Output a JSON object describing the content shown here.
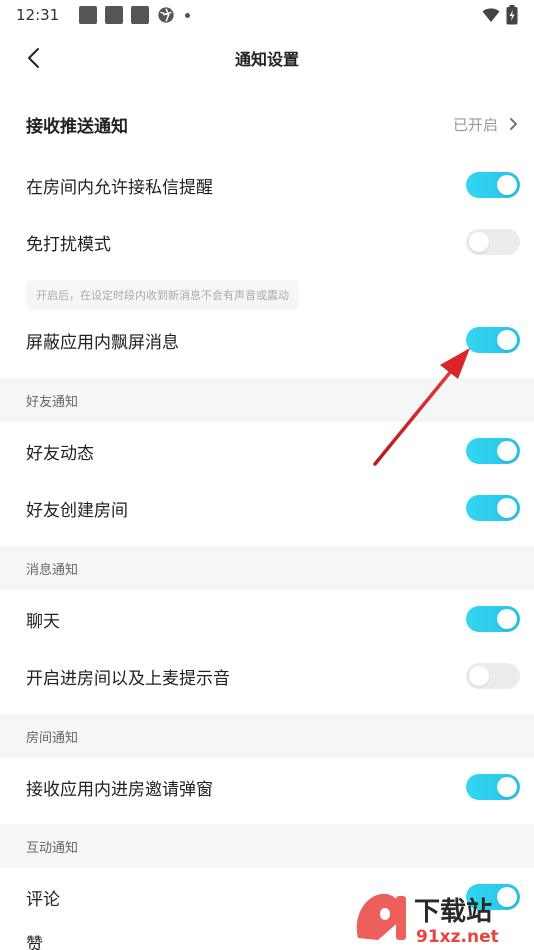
{
  "status_bar": {
    "time": "12:31"
  },
  "header": {
    "title": "通知设置"
  },
  "push": {
    "label": "接收推送通知",
    "status": "已开启"
  },
  "rows": {
    "private_msg": {
      "label": "在房间内允许接私信提醒",
      "on": true
    },
    "dnd": {
      "label": "免打扰模式",
      "on": false
    },
    "dnd_hint": "开启后，在设定时段内收到新消息不会有声音或震动",
    "floating": {
      "label": "屏蔽应用内飘屏消息",
      "on": true
    },
    "friend_feed": {
      "label": "好友动态",
      "on": true
    },
    "friend_room": {
      "label": "好友创建房间",
      "on": true
    },
    "chat": {
      "label": "聊天",
      "on": true
    },
    "enter_room_sound": {
      "label": "开启进房间以及上麦提示音",
      "on": false
    },
    "room_invite": {
      "label": "接收应用内进房邀请弹窗",
      "on": true
    },
    "comment": {
      "label": "评论",
      "on": true
    },
    "like": {
      "label": "赞"
    }
  },
  "sections": {
    "friend": "好友通知",
    "message": "消息通知",
    "room": "房间通知",
    "interaction": "互动通知"
  },
  "watermark": {
    "site": "下载站",
    "domain": "91xz.net"
  },
  "colors": {
    "toggle_on": "#2fcfee",
    "toggle_off": "#ececec",
    "arrow": "#d9252b",
    "section_bg": "#f5f6f8"
  }
}
